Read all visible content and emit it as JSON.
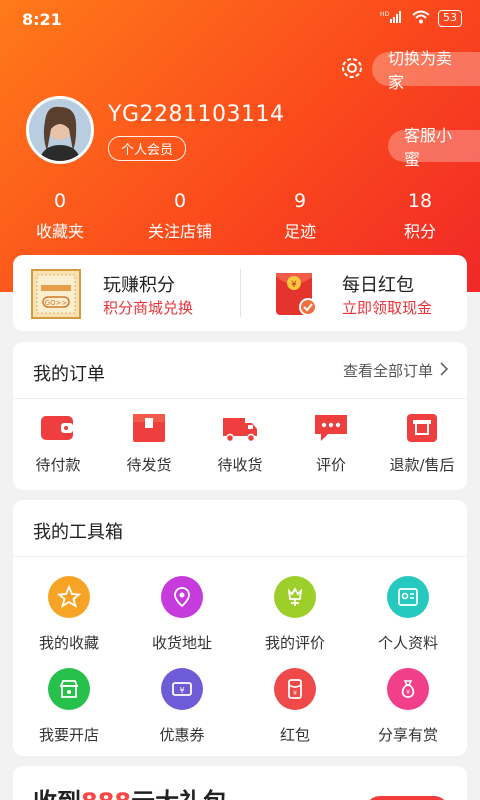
{
  "status": {
    "time": "8:21",
    "hd": "HD",
    "battery": "53"
  },
  "header": {
    "switch_label": "切换为卖家",
    "service_label": "客服小蜜",
    "username": "YG2281103114",
    "member_badge": "个人会员"
  },
  "stats": [
    {
      "value": "0",
      "label": "收藏夹"
    },
    {
      "value": "0",
      "label": "关注店铺"
    },
    {
      "value": "9",
      "label": "足迹"
    },
    {
      "value": "18",
      "label": "积分"
    }
  ],
  "promo": {
    "points": {
      "title": "玩赚积分",
      "subtitle": "积分商城兑换",
      "icon_text": "GO>>"
    },
    "redpack": {
      "title": "每日红包",
      "subtitle": "立即领取现金"
    }
  },
  "orders": {
    "title": "我的订单",
    "view_all": "查看全部订单",
    "items": [
      {
        "label": "待付款",
        "icon": "wallet-icon"
      },
      {
        "label": "待发货",
        "icon": "package-icon"
      },
      {
        "label": "待收货",
        "icon": "truck-icon"
      },
      {
        "label": "评价",
        "icon": "comment-icon"
      },
      {
        "label": "退款/售后",
        "icon": "refund-icon"
      }
    ]
  },
  "tools": {
    "title": "我的工具箱",
    "items": [
      {
        "label": "我的收藏",
        "icon": "star-icon",
        "color": "#f7a426"
      },
      {
        "label": "收货地址",
        "icon": "location-icon",
        "color": "#c63bdc"
      },
      {
        "label": "我的评价",
        "icon": "flower-icon",
        "color": "#9ccf2a"
      },
      {
        "label": "个人资料",
        "icon": "profile-icon",
        "color": "#26c9c0"
      },
      {
        "label": "我要开店",
        "icon": "shop-icon",
        "color": "#26c04a"
      },
      {
        "label": "优惠券",
        "icon": "coupon-icon",
        "color": "#6e5cd6"
      },
      {
        "label": "红包",
        "icon": "redpacket-icon",
        "color": "#ef4a4a"
      },
      {
        "label": "分享有赏",
        "icon": "moneybag-icon",
        "color": "#f23f8a"
      }
    ]
  },
  "gift": {
    "prefix": "收到",
    "amount": "888",
    "suffix": "元大礼包"
  },
  "colors": {
    "accent": "#f0332f",
    "header_start": "#ff7a1a",
    "header_end": "#f02828"
  }
}
